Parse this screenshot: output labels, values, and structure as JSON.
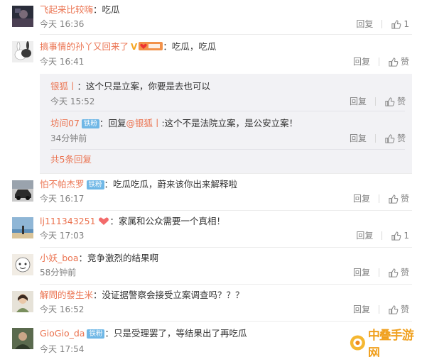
{
  "comments": [
    {
      "name": "飞起来比较嗨",
      "sep": "：",
      "text": "吃瓜",
      "time": "今天 16:36",
      "reply": "回复",
      "like": "1",
      "avatar": "dark-portrait"
    },
    {
      "name": "搞事情的孙丫又回来了",
      "vbadge": "V",
      "sep": "：",
      "text": "吃瓜，吃瓜",
      "time": "今天 16:41",
      "reply": "回复",
      "like": "赞",
      "avatar": "rabbit"
    },
    {
      "name": "怕不帕杰罗",
      "badge": "铁粉",
      "sep": "：",
      "text": "吃瓜吃瓜，蔚来该你出来解释啦",
      "time": "今天 16:17",
      "reply": "回复",
      "like": "赞",
      "avatar": "car"
    },
    {
      "name": "lj111343251",
      "sep": "：",
      "text": "家属和公众需要一个真相！",
      "time": "今天 17:03",
      "reply": "回复",
      "like": "1",
      "avatar": "beach"
    },
    {
      "name": "小妖_boa",
      "sep": "：",
      "text": "竞争激烈的结果啊",
      "time": "58分钟前",
      "reply": "回复",
      "like": "赞",
      "avatar": "cartoon"
    },
    {
      "name": "解問的發生米",
      "sep": "：",
      "text": "没证据警察会接受立案调查吗？？？",
      "time": "今天 16:52",
      "reply": "回复",
      "like": "赞",
      "avatar": "girl"
    },
    {
      "name": "GioGio_da",
      "badge": "铁粉",
      "sep": "：",
      "text": "只是受理罢了，等结果出了再吃瓜",
      "time": "今天 17:54",
      "reply": "回复",
      "like": "赞",
      "avatar": "person"
    }
  ],
  "replies": [
    {
      "name": "银狐丨",
      "sep": "：",
      "text": "这个只是立案，你要是去也可以",
      "time": "今天 15:52",
      "reply": "回复",
      "like": "赞"
    },
    {
      "name": "坊间07",
      "badge": "铁粉",
      "sep": "：",
      "prefix": "回复",
      "mention": "@银狐丨",
      "text": ":这个不是法院立案，是公安立案！",
      "time": "34分钟前",
      "reply": "回复",
      "like": "赞"
    }
  ],
  "more_replies": "共5条回复",
  "watermark": "中叠手游网",
  "colors": {
    "name": "#eb7350",
    "badge_blue": "#6fb7e6",
    "time": "#808080",
    "reply_bg": "#f2f2f5"
  }
}
